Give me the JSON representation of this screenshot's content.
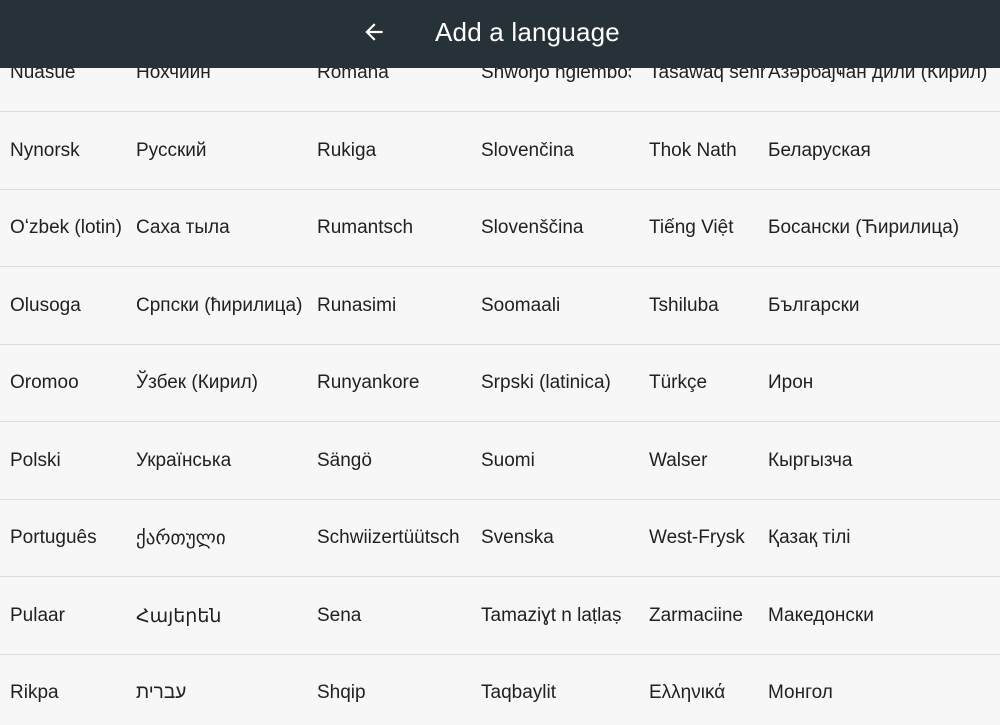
{
  "appbar": {
    "title": "Add a language",
    "back_icon": "arrow-left-icon"
  },
  "languages": [
    [
      "Nuasue",
      "Нохчийн",
      "Română",
      "Shwóŋò ngiemboɔn",
      "Tasawaq senni",
      "Азәрбајҹан дили (Кирил)"
    ],
    [
      "Nynorsk",
      "Русский",
      "Rukiga",
      "Slovenčina",
      "Thok Nath",
      "Беларуская"
    ],
    [
      "Oʻzbek (lotin)",
      "Саха тыла",
      "Rumantsch",
      "Slovenščina",
      "Tiếng Việt",
      "Босански (Ћирилица)"
    ],
    [
      "Olusoga",
      "Српски (ћирилица)",
      "Runasimi",
      "Soomaali",
      "Tshiluba",
      "Български"
    ],
    [
      "Oromoo",
      "Ўзбек (Кирил)",
      "Runyankore",
      "Srpski (latinica)",
      "Türkçe",
      "Ирон"
    ],
    [
      "Polski",
      "Українська",
      "Sängö",
      "Suomi",
      "Walser",
      "Кыргызча"
    ],
    [
      "Português",
      "ქართული",
      "Schwiizertüütsch",
      "Svenska",
      "West-Frysk",
      "Қазақ тілі"
    ],
    [
      "Pulaar",
      "Հայերեն",
      "Sena",
      "Tamaziɣt n laṭlaṣ",
      "Zarmaciine",
      "Македонски"
    ],
    [
      "Rikpa",
      "עברית",
      "Shqip",
      "Taqbaylit",
      "Ελληνικά",
      "Монгол"
    ]
  ]
}
